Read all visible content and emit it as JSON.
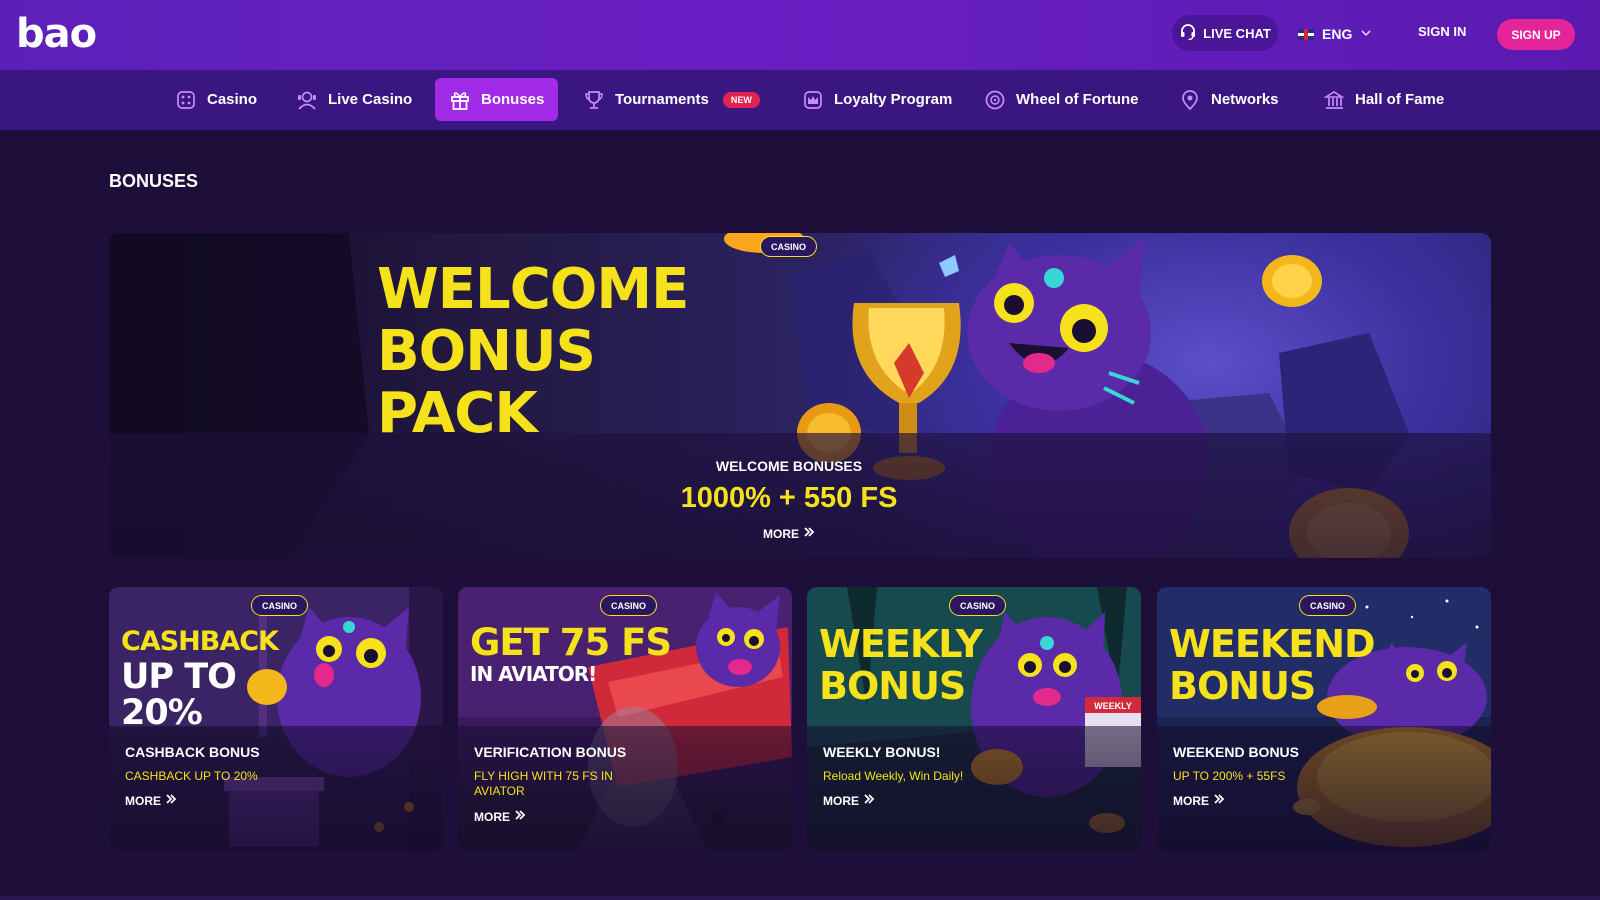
{
  "header": {
    "logo": "bao",
    "live_chat": "LIVE CHAT",
    "language": "ENG",
    "sign_in": "SIGN IN",
    "sign_up": "SIGN UP"
  },
  "nav": {
    "items": [
      {
        "label": "Casino",
        "icon": "dice-icon"
      },
      {
        "label": "Live Casino",
        "icon": "dealer-icon"
      },
      {
        "label": "Bonuses",
        "icon": "gift-icon",
        "active": true
      },
      {
        "label": "Tournaments",
        "icon": "trophy-icon",
        "badge": "NEW"
      },
      {
        "label": "Loyalty Program",
        "icon": "crown-icon"
      },
      {
        "label": "Wheel of Fortune",
        "icon": "wheel-icon"
      },
      {
        "label": "Networks",
        "icon": "network-icon"
      },
      {
        "label": "Hall of Fame",
        "icon": "hall-icon"
      }
    ]
  },
  "page": {
    "title": "BONUSES"
  },
  "hero": {
    "badge": "CASINO",
    "heading_lines": [
      "WELCOME",
      "BONUS",
      "PACK"
    ],
    "subtitle": "WELCOME BONUSES",
    "amount": "1000% + 550 FS",
    "more": "MORE"
  },
  "cards": [
    {
      "badge": "CASINO",
      "heading_lines": [
        "CASHBACK",
        "UP TO",
        "20%"
      ],
      "title": "CASHBACK BONUS",
      "description": "CASHBACK UP TO 20%",
      "more": "MORE"
    },
    {
      "badge": "CASINO",
      "heading_lines": [
        "GET 75 FS",
        "IN AVIATOR!"
      ],
      "title": "VERIFICATION BONUS",
      "description": "FLY HIGH WITH 75 FS IN AVIATOR",
      "more": "MORE"
    },
    {
      "badge": "CASINO",
      "heading_lines": [
        "WEEKLY",
        "BONUS"
      ],
      "title": "WEEKLY BONUS!",
      "description": "Reload Weekly, Win Daily!",
      "more": "MORE",
      "art_label": "WEEKLY"
    },
    {
      "badge": "CASINO",
      "heading_lines": [
        "WEEKEND",
        "BONUS"
      ],
      "title": "WEEKEND BONUS",
      "description": "UP TO 200% + 55FS",
      "more": "MORE"
    }
  ],
  "colors": {
    "header_bg": "#6a1fc4",
    "nav_bg": "#3a1780",
    "active_tab": "#a12ae6",
    "accent_yellow": "#f5e21a",
    "sign_up_pink": "#e4259a",
    "new_badge_red": "#e3234f",
    "page_bg": "#1d0f3a"
  }
}
